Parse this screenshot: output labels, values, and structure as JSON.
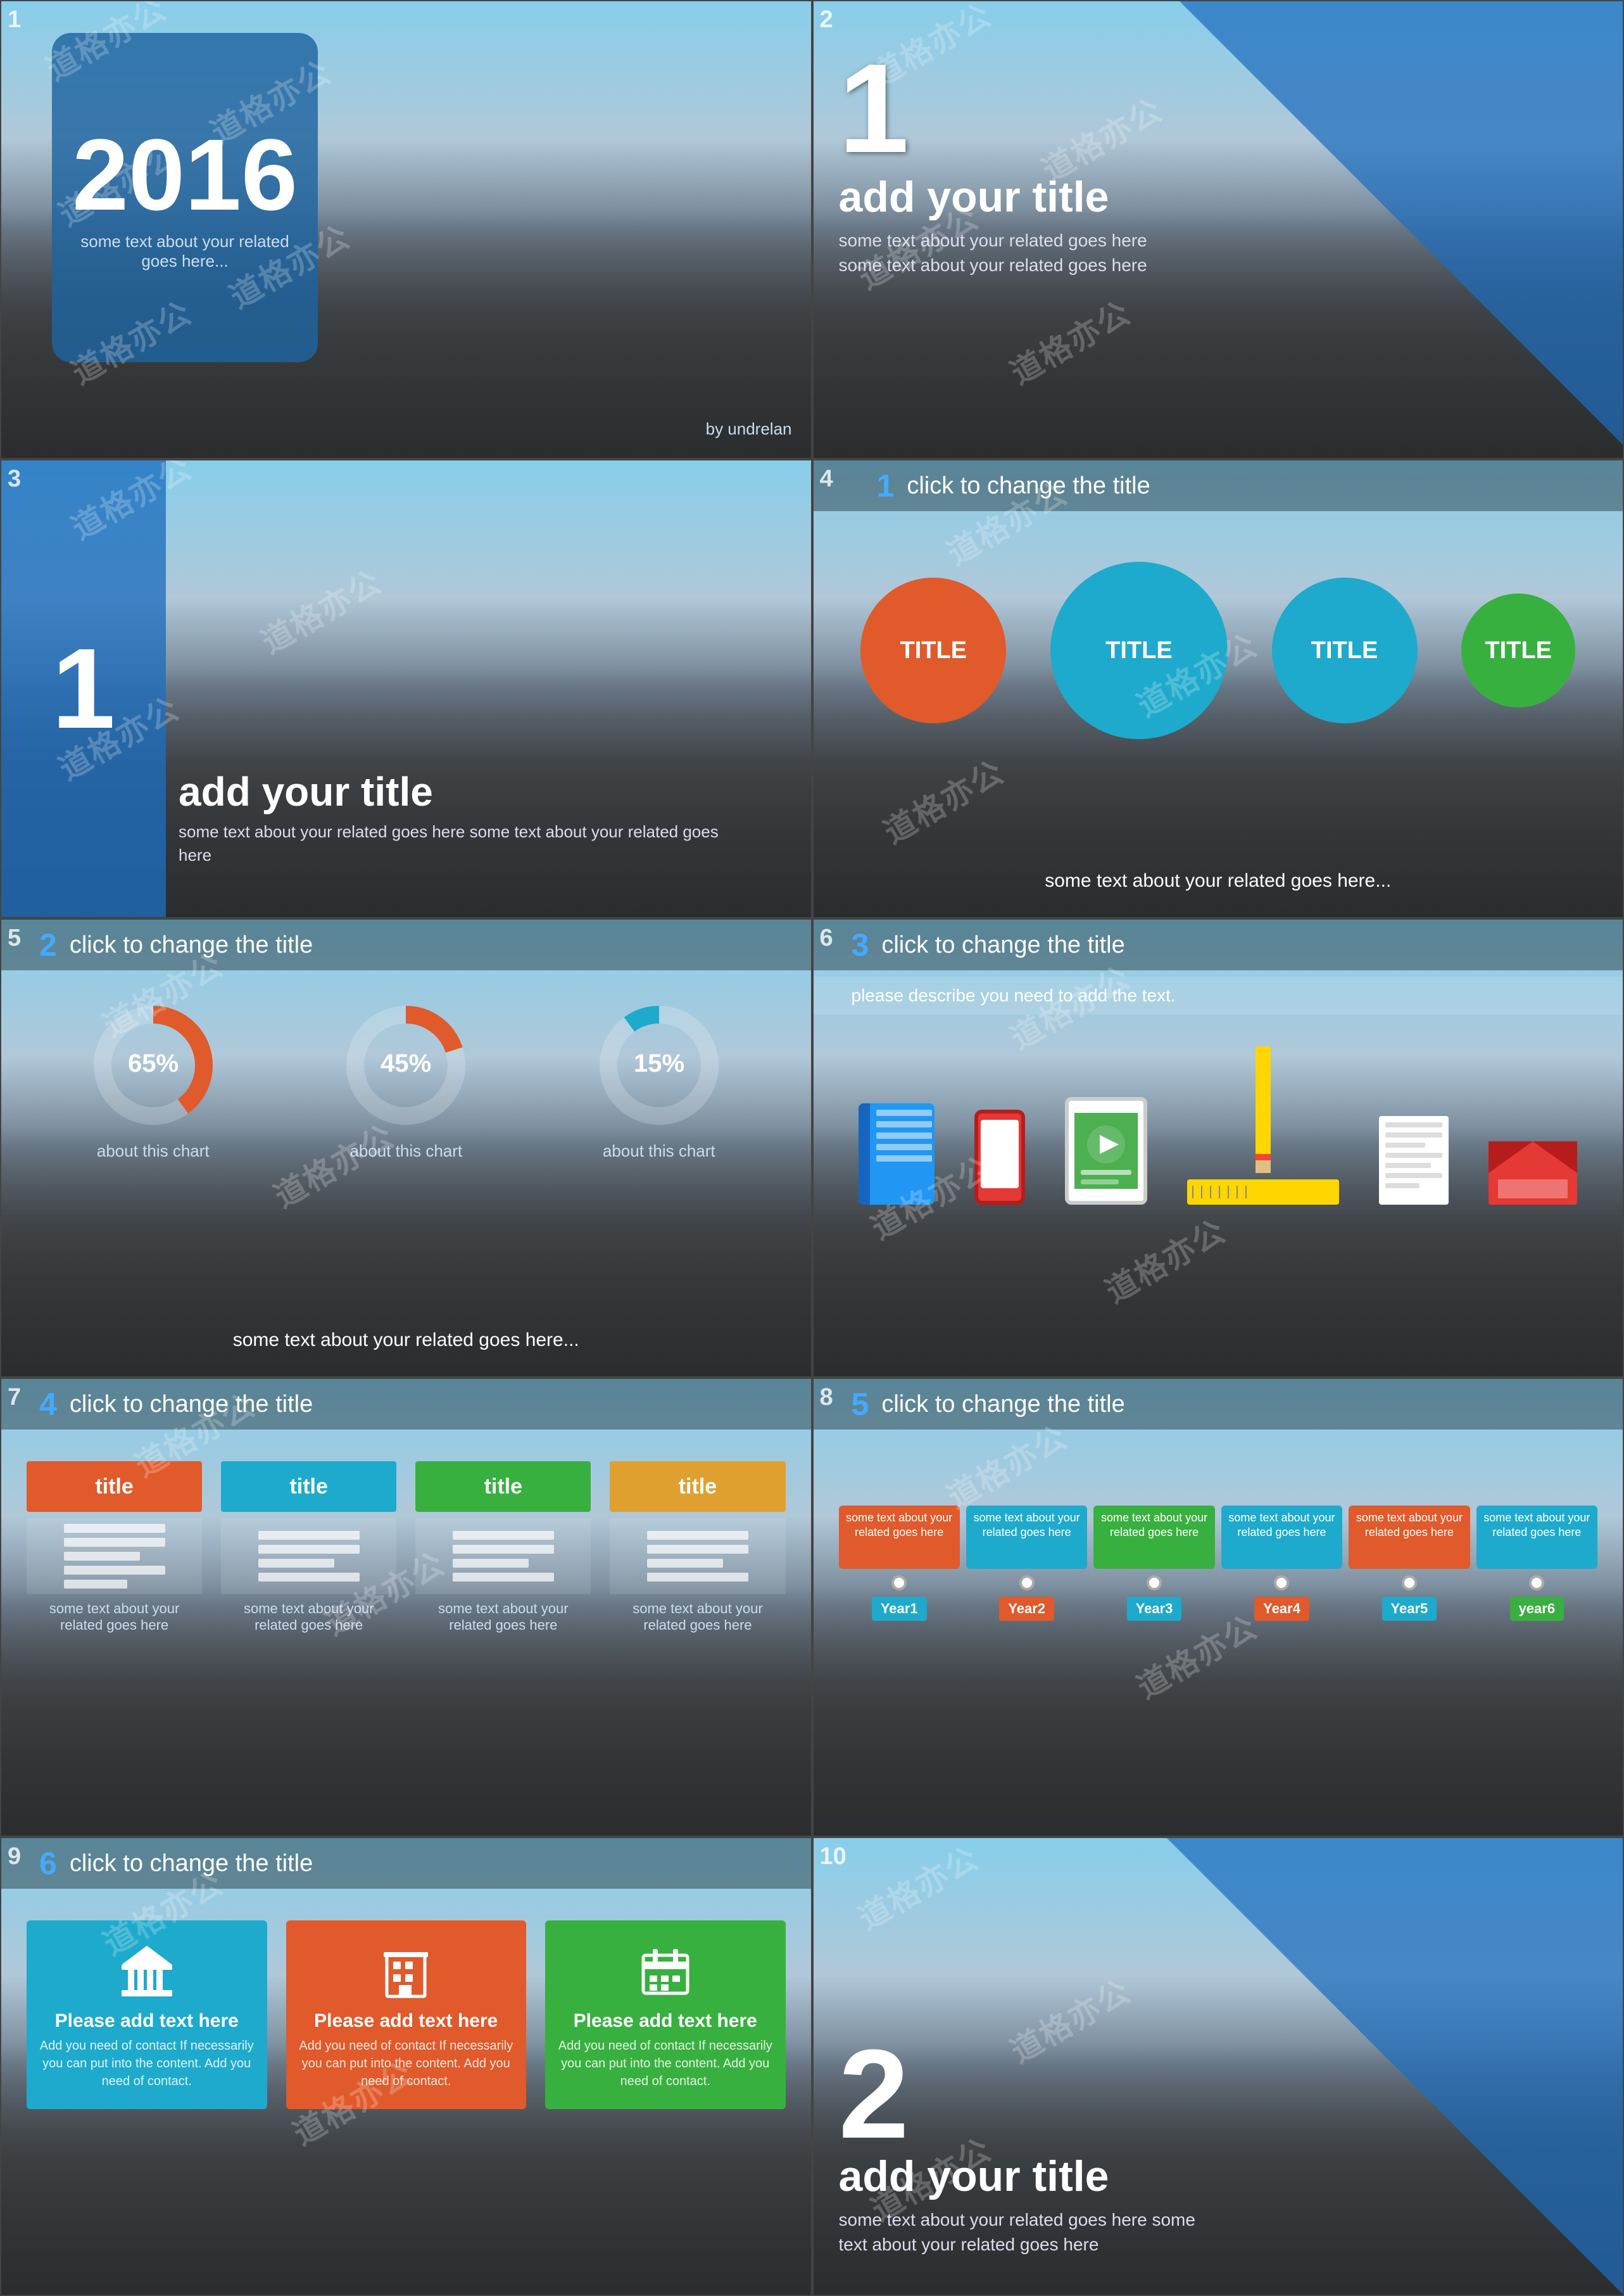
{
  "watermark": "道格亦公",
  "slides": [
    {
      "id": 1,
      "year": "2016",
      "sub_text": "some text about your  related goes here...",
      "by_text": "by undrelan"
    },
    {
      "id": 2,
      "num": "1",
      "title": "add your title",
      "desc": "some text about your  related goes here some text about your  related goes here"
    },
    {
      "id": 3,
      "num": "1",
      "title": "add your title",
      "desc": "some text about your  related goes here some text about your  related goes here"
    },
    {
      "id": 4,
      "slide_num": "1",
      "top_title": "click to change the title",
      "circles": [
        {
          "label": "TITLE",
          "color": "#e05a2b",
          "size": "sm"
        },
        {
          "label": "TITLE",
          "color": "#1eaacc",
          "size": "md"
        },
        {
          "label": "TITLE",
          "color": "#1eaacc",
          "size": "sm"
        },
        {
          "label": "TITLE",
          "color": "#38b040",
          "size": "xs"
        }
      ],
      "bottom_text": "some text about your  related goes here..."
    },
    {
      "id": 5,
      "slide_num": "2",
      "top_title": "click to change the title",
      "donuts": [
        {
          "percent": 65,
          "color": "#e05a2b",
          "label": "about this chart"
        },
        {
          "percent": 45,
          "color": "#e05a2b",
          "label": "about this chart"
        },
        {
          "percent": 15,
          "color": "#1eaacc",
          "label": "about this chart"
        }
      ],
      "bottom_text": "some text about your  related goes here..."
    },
    {
      "id": 6,
      "slide_num": "3",
      "top_title": "click to change the title",
      "desc_bar": "please describe you need to add the text."
    },
    {
      "id": 7,
      "slide_num": "4",
      "top_title": "click to change the title",
      "cols": [
        {
          "header": "title",
          "color": "#e05a2b",
          "text": "some text about your related goes here"
        },
        {
          "header": "title",
          "color": "#1eaacc",
          "text": "some text about your related goes here"
        },
        {
          "header": "title",
          "color": "#38b040",
          "text": "some text about your related goes here"
        },
        {
          "header": "title",
          "color": "#e0a030",
          "text": "some text about your related goes here"
        }
      ]
    },
    {
      "id": 8,
      "slide_num": "5",
      "top_title": "click to change the title",
      "timeline_items": [
        {
          "text": "some text about your related goes here",
          "color": "#e05a2b",
          "year": "Year1",
          "year_color": "#1eaacc"
        },
        {
          "text": "some text about your related goes here",
          "color": "#1eaacc",
          "year": "Year2",
          "year_color": "#e05a2b"
        },
        {
          "text": "some text about your related goes here",
          "color": "#38b040",
          "year": "Year3",
          "year_color": "#1eaacc"
        },
        {
          "text": "some text about your related goes here",
          "color": "#1eaacc",
          "year": "Year4",
          "year_color": "#e05a2b"
        },
        {
          "text": "some text about your related goes here",
          "color": "#e05a2b",
          "year": "Year5",
          "year_color": "#1eaacc"
        },
        {
          "text": "some text about your related goes here",
          "color": "#1eaacc",
          "year": "year6",
          "year_color": "#38b040"
        }
      ]
    },
    {
      "id": 9,
      "slide_num": "6",
      "top_title": "click to change the title",
      "cards": [
        {
          "color": "#1eaacc",
          "title": "Please add text here",
          "sub": "Add you need of contact If necessarily you can put into the content. Add you need of contact."
        },
        {
          "color": "#e05a2b",
          "title": "Please add text here",
          "sub": "Add you need of contact If necessarily you can put into the content. Add you need of contact."
        },
        {
          "color": "#38b040",
          "title": "Please add text here",
          "sub": "Add you need of contact If necessarily you can put into the content. Add you need of contact."
        }
      ]
    },
    {
      "id": 10,
      "num": "2",
      "title": "add your title",
      "desc": "some text about your  related goes here some text about your  related goes here"
    }
  ]
}
